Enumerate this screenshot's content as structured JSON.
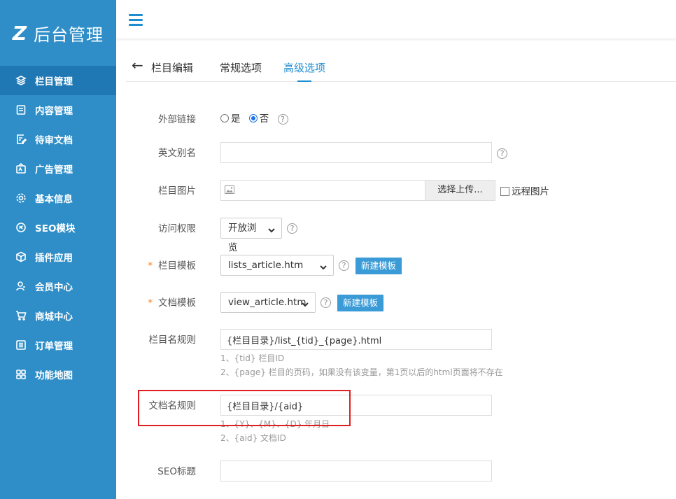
{
  "logo": {
    "mark": "Z",
    "text": "后台管理"
  },
  "sidebar": {
    "items": [
      {
        "label": "栏目管理",
        "icon": "layers-icon",
        "active": true
      },
      {
        "label": "内容管理",
        "icon": "document-icon"
      },
      {
        "label": "待审文档",
        "icon": "edit-document-icon"
      },
      {
        "label": "广告管理",
        "icon": "ad-icon"
      },
      {
        "label": "基本信息",
        "icon": "gear-icon"
      },
      {
        "label": "SEO模块",
        "icon": "seo-icon"
      },
      {
        "label": "插件应用",
        "icon": "cube-icon"
      },
      {
        "label": "会员中心",
        "icon": "user-icon"
      },
      {
        "label": "商城中心",
        "icon": "cart-icon"
      },
      {
        "label": "订单管理",
        "icon": "list-icon"
      },
      {
        "label": "功能地图",
        "icon": "grid-icon"
      }
    ]
  },
  "tabs": {
    "back": "←",
    "title": "栏目编辑",
    "items": [
      "常规选项",
      "高级选项"
    ],
    "active": 1
  },
  "form": {
    "external_link": {
      "label": "外部链接",
      "yes": "是",
      "no": "否",
      "selected": "否",
      "help": "?"
    },
    "english_alias": {
      "label": "英文别名",
      "value": "",
      "help": "?"
    },
    "column_image": {
      "label": "栏目图片",
      "button": "选择上传...",
      "remote": "远程图片"
    },
    "access": {
      "label": "访问权限",
      "value": "开放浏览",
      "help": "?"
    },
    "column_template": {
      "required": "*",
      "label": "栏目模板",
      "value": "lists_article.htm",
      "help": "?",
      "button": "新建模板"
    },
    "doc_template": {
      "required": "*",
      "label": "文档模板",
      "value": "view_article.htm",
      "help": "?",
      "button": "新建模板"
    },
    "column_rule": {
      "label": "栏目名规则",
      "value": "{栏目目录}/list_{tid}_{page}.html",
      "hint1": "1、{tid} 栏目ID",
      "hint2": "2、{page} 栏目的页码，如果没有该变量，第1页以后的html页面将不存在"
    },
    "doc_rule": {
      "label": "文档名规则",
      "value": "{栏目目录}/{aid}",
      "hint1": "1、{Y}、{M}、{D} 年月日",
      "hint2": "2、{aid} 文档ID"
    },
    "seo_title": {
      "label": "SEO标题",
      "value": ""
    }
  },
  "colors": {
    "sidebar": "#2f8ec8",
    "accent": "#1f8ed0",
    "highlight": "#e02020"
  }
}
